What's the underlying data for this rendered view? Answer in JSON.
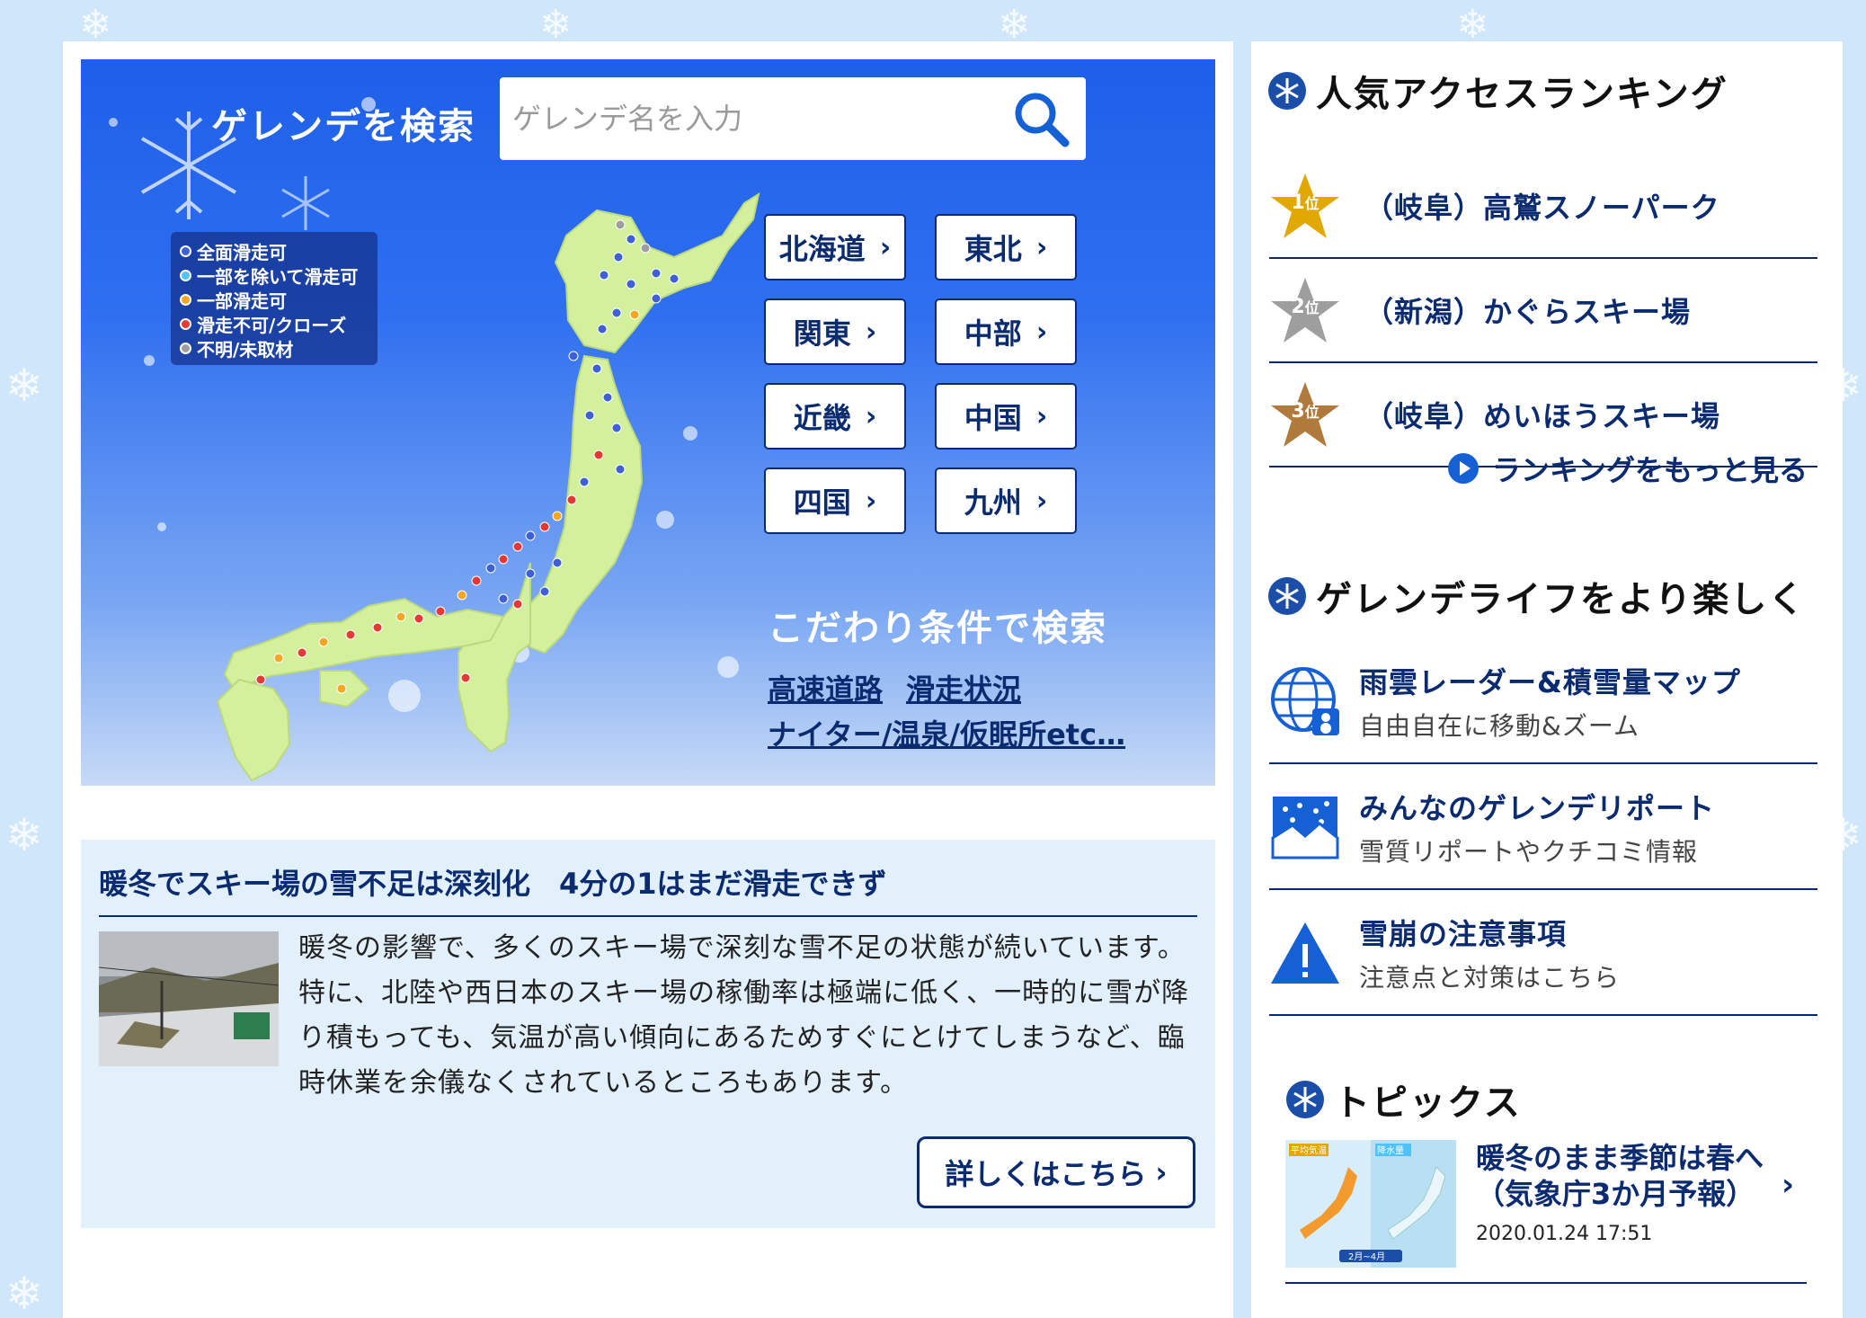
{
  "hero": {
    "title": "ゲレンデを検索",
    "search_placeholder": "ゲレンデ名を入力",
    "legend": [
      {
        "label": "全面滑走可",
        "color": "#3f5fd4"
      },
      {
        "label": "一部を除いて滑走可",
        "color": "#4fc3f7"
      },
      {
        "label": "一部滑走可",
        "color": "#f5a623"
      },
      {
        "label": "滑走不可/クローズ",
        "color": "#e53935"
      },
      {
        "label": "不明/未取材",
        "color": "#9e9e9e"
      }
    ],
    "regions": [
      "北海道",
      "東北",
      "関東",
      "中部",
      "近畿",
      "中国",
      "四国",
      "九州"
    ],
    "conditions_title": "こだわり条件で検索",
    "condition_links": [
      "高速道路",
      "滑走状況",
      "ナイター/温泉/仮眠所etc…"
    ]
  },
  "news": {
    "title": "暖冬でスキー場の雪不足は深刻化　4分の1はまだ滑走できず",
    "body": "暖冬の影響で、多くのスキー場で深刻な雪不足の状態が続いています。 特に、北陸や西日本のスキー場の稼働率は極端に低く、一時的に雪が降り積もっても、気温が高い傾向にあるためすぐにとけてしまうなど、臨時休業を余儀なくされているところもあります。",
    "more_label": "詳しくはこちら"
  },
  "ranking": {
    "heading": "人気アクセスランキング",
    "items": [
      {
        "rank": "1",
        "suffix": "位",
        "name": "（岐阜）高鷲スノーパーク",
        "color": "#e0a800"
      },
      {
        "rank": "2",
        "suffix": "位",
        "name": "（新潟）かぐらスキー場",
        "color": "#9e9e9e"
      },
      {
        "rank": "3",
        "suffix": "位",
        "name": "（岐阜）めいほうスキー場",
        "color": "#b07a3a"
      }
    ],
    "more_label": "ランキングをもっと見る"
  },
  "features": {
    "heading": "ゲレンデライフをより楽しく",
    "items": [
      {
        "icon": "globe-icon",
        "title": "雨雲レーダー&積雪量マップ",
        "sub": "自由自在に移動&ズーム"
      },
      {
        "icon": "snow-report-icon",
        "title": "みんなのゲレンデリポート",
        "sub": "雪質リポートやクチコミ情報"
      },
      {
        "icon": "warning-icon",
        "title": "雪崩の注意事項",
        "sub": "注意点と対策はこちら"
      }
    ]
  },
  "topics": {
    "heading": "トピックス",
    "items": [
      {
        "title": "暖冬のまま季節は春へ（気象庁3か月予報）",
        "date": "2020.01.24 17:51",
        "thumb_left": "平均気温",
        "thumb_right": "降水量",
        "thumb_period": "2月~4月"
      }
    ]
  }
}
